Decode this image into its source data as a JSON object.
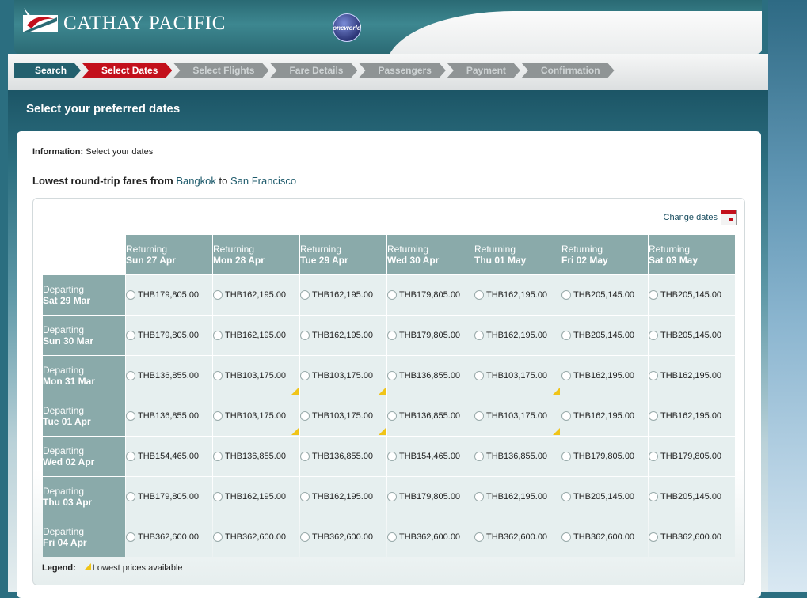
{
  "header": {
    "logo_text": "CATHAY PACIFIC",
    "alliance_badge": "oneworld"
  },
  "steps": [
    {
      "label": "Search",
      "state": "done"
    },
    {
      "label": "Select Dates",
      "state": "current"
    },
    {
      "label": "Select Flights",
      "state": "inactive"
    },
    {
      "label": "Fare Details",
      "state": "inactive"
    },
    {
      "label": "Passengers",
      "state": "inactive"
    },
    {
      "label": "Payment",
      "state": "inactive"
    },
    {
      "label": "Confirmation",
      "state": "inactive"
    }
  ],
  "page_title": "Select your preferred dates",
  "info": {
    "label": "Information:",
    "text": "Select your dates"
  },
  "route": {
    "prefix": "Lowest round-trip fares from",
    "origin": "Bangkok",
    "to": "to",
    "destination": "San Francisco"
  },
  "change_dates_label": "Change dates",
  "grid": {
    "return_label": "Returning",
    "depart_label": "Departing",
    "returning_dates": [
      "Sun 27 Apr",
      "Mon 28 Apr",
      "Tue 29 Apr",
      "Wed 30 Apr",
      "Thu 01 May",
      "Fri 02 May",
      "Sat 03 May"
    ],
    "departing_dates": [
      "Sat 29 Mar",
      "Sun 30 Mar",
      "Mon 31 Mar",
      "Tue 01 Apr",
      "Wed 02 Apr",
      "Thu 03 Apr",
      "Fri 04 Apr"
    ],
    "fares": [
      [
        "THB179,805.00",
        "THB162,195.00",
        "THB162,195.00",
        "THB179,805.00",
        "THB162,195.00",
        "THB205,145.00",
        "THB205,145.00"
      ],
      [
        "THB179,805.00",
        "THB162,195.00",
        "THB162,195.00",
        "THB179,805.00",
        "THB162,195.00",
        "THB205,145.00",
        "THB205,145.00"
      ],
      [
        "THB136,855.00",
        "THB103,175.00",
        "THB103,175.00",
        "THB136,855.00",
        "THB103,175.00",
        "THB162,195.00",
        "THB162,195.00"
      ],
      [
        "THB136,855.00",
        "THB103,175.00",
        "THB103,175.00",
        "THB136,855.00",
        "THB103,175.00",
        "THB162,195.00",
        "THB162,195.00"
      ],
      [
        "THB154,465.00",
        "THB136,855.00",
        "THB136,855.00",
        "THB154,465.00",
        "THB136,855.00",
        "THB179,805.00",
        "THB179,805.00"
      ],
      [
        "THB179,805.00",
        "THB162,195.00",
        "THB162,195.00",
        "THB179,805.00",
        "THB162,195.00",
        "THB205,145.00",
        "THB205,145.00"
      ],
      [
        "THB362,600.00",
        "THB362,600.00",
        "THB362,600.00",
        "THB362,600.00",
        "THB362,600.00",
        "THB362,600.00",
        "THB362,600.00"
      ]
    ],
    "lowest_marked": [
      [
        2,
        1
      ],
      [
        2,
        2
      ],
      [
        2,
        4
      ],
      [
        3,
        1
      ],
      [
        3,
        2
      ],
      [
        3,
        4
      ]
    ]
  },
  "legend": {
    "label": "Legend:",
    "text": "Lowest prices available"
  },
  "colors": {
    "brand_teal": "#23606e",
    "current_step_red": "#c3101c",
    "lowest_marker": "#f0c418"
  }
}
